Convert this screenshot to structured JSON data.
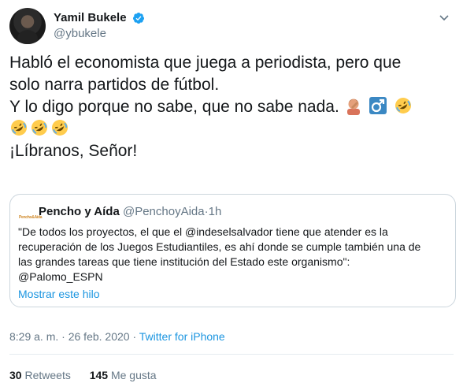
{
  "author": {
    "display_name": "Yamil Bukele",
    "handle": "@ybukele",
    "verified": true,
    "avatar_icon": "avatar-photo"
  },
  "tweet": {
    "lines": [
      "Habló el economista que juega a periodista, pero que",
      "solo narra partidos de fútbol.",
      "Y lo digo porque no sabe, que no sabe nada.",
      "¡Líbranos, Señor!"
    ],
    "emoji_after_line3": [
      "facepalm-emoji",
      "male-sign-emoji",
      "rofl-emoji"
    ],
    "emoji_line": [
      "rofl-emoji",
      "rofl-emoji",
      "rofl-emoji"
    ]
  },
  "quote": {
    "logo_text": "Pencho&Aída",
    "name": "Pencho y Aída",
    "handle": "@PenchoyAida",
    "dot": "·",
    "time": "1h",
    "lines": [
      "\"De todos los proyectos, el que el @indeselsalvador tiene que atender es la",
      "recuperación de los Juegos Estudiantiles, es ahí donde se cumple también una de",
      "las grandes tareas que tiene institución del Estado este organismo\":",
      "@Palomo_ESPN"
    ],
    "thread_link": "Mostrar este hilo"
  },
  "meta": {
    "time": "8:29 a. m.",
    "sep": "·",
    "date": "26 feb. 2020",
    "sep2": "·",
    "source": "Twitter for iPhone"
  },
  "stats": {
    "retweets_count": "30",
    "retweets_label": "Retweets",
    "likes_count": "145",
    "likes_label": "Me gusta"
  },
  "colors": {
    "link": "#1b95e0",
    "muted": "#657786",
    "text": "#14171a",
    "border": "#ccd6dd"
  }
}
